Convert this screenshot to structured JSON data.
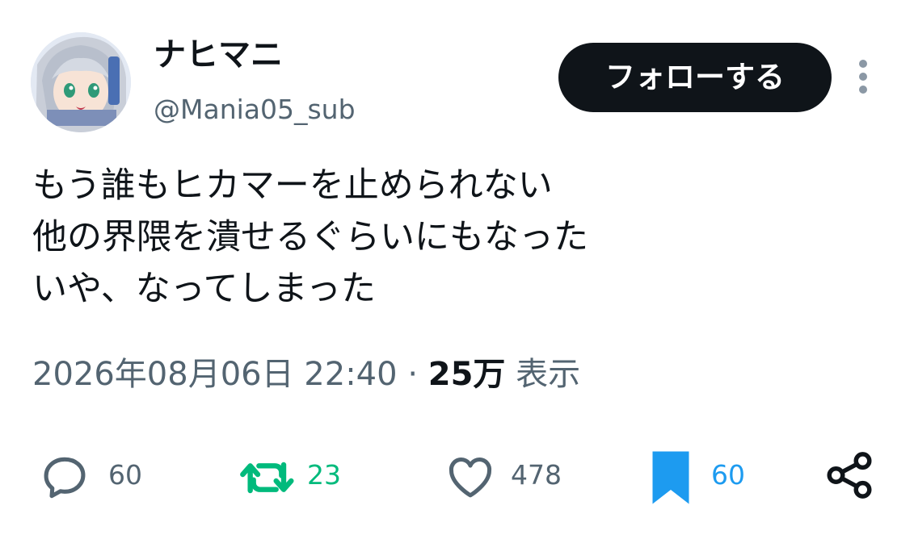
{
  "user": {
    "display_name": "ナヒマニ",
    "handle": "@Mania05_sub"
  },
  "follow_button": {
    "label": "フォローする"
  },
  "tweet": {
    "lines": [
      "もう誰もヒカマーを止められない",
      "他の界隈を潰せるぐらいにもなった",
      "いや、なってしまった"
    ]
  },
  "meta": {
    "timestamp": "2026年08月06日 22:40",
    "separator": "·",
    "views_count": "25万",
    "views_label": "表示"
  },
  "actions": {
    "reply_count": "60",
    "retweet_count": "23",
    "like_count": "478",
    "bookmark_count": "60"
  },
  "colors": {
    "text_primary": "#0f1419",
    "text_secondary": "#536471",
    "retweet_active": "#00ba7c",
    "bookmark_active": "#1d9bf0",
    "button_bg": "#0f1419"
  },
  "icons": [
    "avatar",
    "more-vertical-icon",
    "reply-icon",
    "retweet-icon",
    "like-icon",
    "bookmark-icon",
    "share-icon"
  ]
}
